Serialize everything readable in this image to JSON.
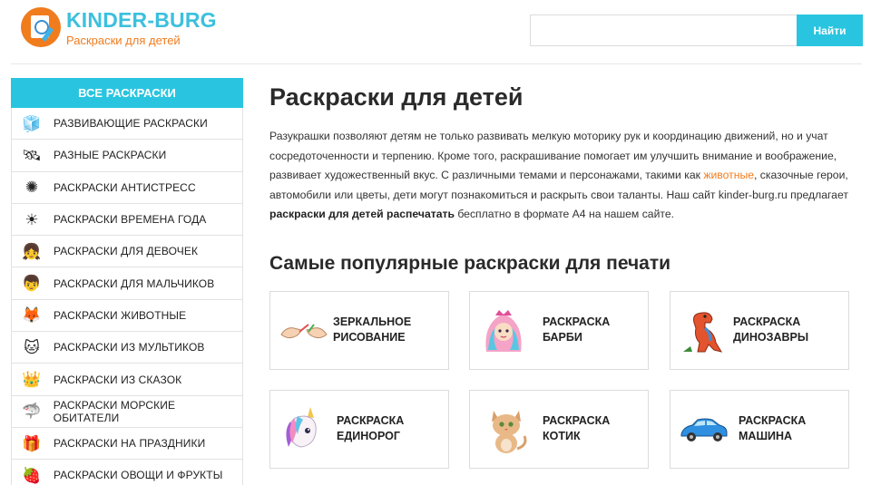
{
  "header": {
    "brand": "KINDER-BURG",
    "tagline": "Раскраски для детей",
    "search_placeholder": "",
    "search_button": "Найти"
  },
  "sidebar": {
    "title": "ВСЕ РАСКРАСКИ",
    "items": [
      {
        "label": "РАЗВИВАЮЩИЕ РАСКРАСКИ",
        "icon": "cubes-icon",
        "glyph": "🧊"
      },
      {
        "label": "РАЗНЫЕ РАСКРАСКИ",
        "icon": "satellite-icon",
        "glyph": "🛰"
      },
      {
        "label": "РАСКРАСКИ АНТИСТРЕСС",
        "icon": "mandala-icon",
        "glyph": "✺"
      },
      {
        "label": "РАСКРАСКИ ВРЕМЕНА ГОДА",
        "icon": "sun-icon",
        "glyph": "☀"
      },
      {
        "label": "РАСКРАСКИ ДЛЯ ДЕВОЧЕК",
        "icon": "girl-icon",
        "glyph": "👧"
      },
      {
        "label": "РАСКРАСКИ ДЛЯ МАЛЬЧИКОВ",
        "icon": "boy-icon",
        "glyph": "👦"
      },
      {
        "label": "РАСКРАСКИ ЖИВОТНЫЕ",
        "icon": "fox-icon",
        "glyph": "🦊"
      },
      {
        "label": "РАСКРАСКИ ИЗ МУЛЬТИКОВ",
        "icon": "cartoon-cat-icon",
        "glyph": "🐱"
      },
      {
        "label": "РАСКРАСКИ ИЗ СКАЗОК",
        "icon": "crown-icon",
        "glyph": "👑"
      },
      {
        "label": "РАСКРАСКИ МОРСКИЕ ОБИТАТЕЛИ",
        "icon": "shark-icon",
        "glyph": "🦈"
      },
      {
        "label": "РАСКРАСКИ НА ПРАЗДНИКИ",
        "icon": "gift-icon",
        "glyph": "🎁"
      },
      {
        "label": "РАСКРАСКИ ОВОЩИ И ФРУКТЫ",
        "icon": "strawberry-icon",
        "glyph": "🍓"
      }
    ]
  },
  "main": {
    "title": "Раскраски для детей",
    "intro": {
      "part1": "Разукрашки позволяют детям не только развивать мелкую моторику рук и координацию движений, но и учат сосредоточенности и терпению. Кроме того, раскрашивание помогает им улучшить внимание и воображение, развивает художественный вкус. С различными темами и персонажами, такими как ",
      "link": "животные",
      "part2": ", сказочные герои, автомобили или цветы, дети могут познакомиться и раскрыть свои таланты. Наш сайт kinder-burg.ru предлагает ",
      "bold": "раскраски для детей распечатать",
      "part3": " бесплатно в формате А4 на нашем сайте."
    },
    "popular_title": "Самые популярные раскраски для печати",
    "cards": [
      {
        "line1": "ЗЕРКАЛЬНОЕ",
        "line2": "РИСОВАНИЕ",
        "icon": "mirror-hands-icon"
      },
      {
        "line1": "РАСКРАСКА",
        "line2": "БАРБИ",
        "icon": "barbie-icon"
      },
      {
        "line1": "РАСКРАСКА",
        "line2": "ДИНОЗАВРЫ",
        "icon": "dinosaur-icon"
      },
      {
        "line1": "РАСКРАСКА",
        "line2": "ЕДИНОРОГ",
        "icon": "unicorn-icon"
      },
      {
        "line1": "РАСКРАСКА",
        "line2": "КОТИК",
        "icon": "kitten-icon"
      },
      {
        "line1": "РАСКРАСКА",
        "line2": "МАШИНА",
        "icon": "car-icon"
      }
    ]
  },
  "colors": {
    "accent": "#29c5e0",
    "brand_orange": "#f07c1e"
  }
}
